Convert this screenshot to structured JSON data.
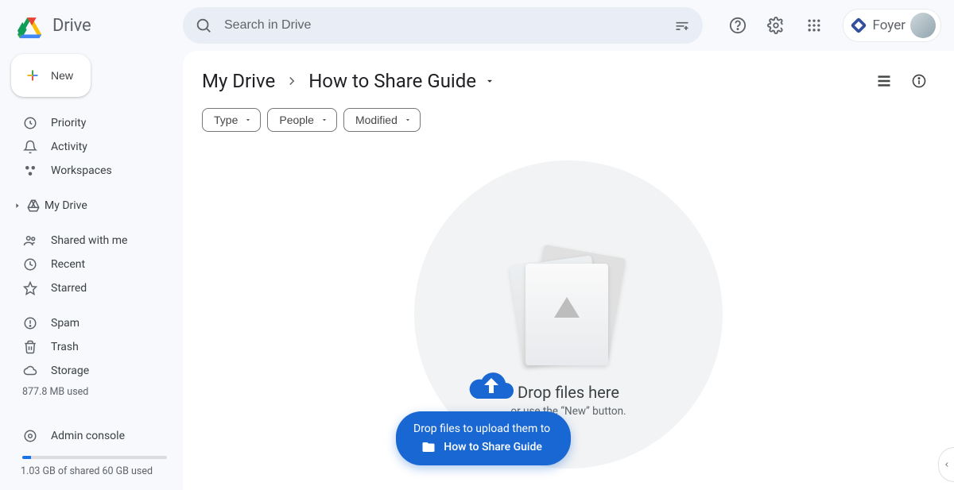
{
  "header": {
    "app_name": "Drive",
    "search_placeholder": "Search in Drive",
    "foyer_label": "Foyer"
  },
  "sidebar": {
    "new_label": "New",
    "items_a": [
      {
        "label": "Priority"
      },
      {
        "label": "Activity"
      },
      {
        "label": "Workspaces"
      }
    ],
    "my_drive_label": "My Drive",
    "items_b": [
      {
        "label": "Shared with me"
      },
      {
        "label": "Recent"
      },
      {
        "label": "Starred"
      }
    ],
    "items_c": [
      {
        "label": "Spam"
      },
      {
        "label": "Trash"
      },
      {
        "label": "Storage"
      }
    ],
    "storage_used": "877.8 MB used",
    "admin_label": "Admin console",
    "storage_shared": "1.03 GB of shared 60 GB used"
  },
  "breadcrumb": {
    "root": "My Drive",
    "current": "How to Share Guide"
  },
  "filters": {
    "type": "Type",
    "people": "People",
    "modified": "Modified"
  },
  "empty": {
    "title": "Drop files here",
    "subtitle": "or use the “New” button."
  },
  "tooltip": {
    "line1": "Drop files to upload them to",
    "folder": "How to Share Guide"
  }
}
